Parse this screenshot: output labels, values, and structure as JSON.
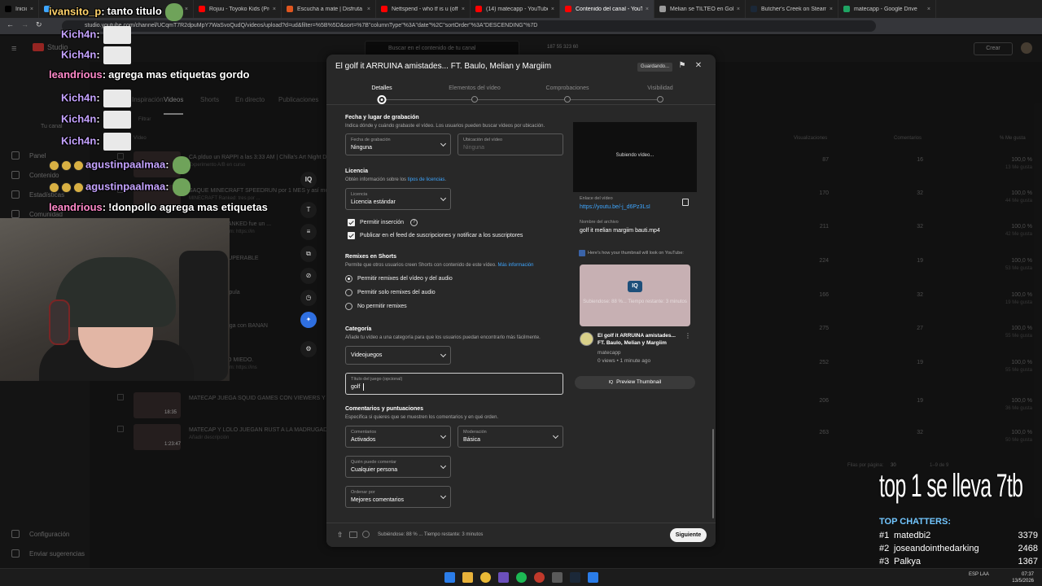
{
  "browser": {
    "tabs": [
      {
        "label": "Inicio / X",
        "color": "#000000",
        "active": false
      },
      {
        "label": "",
        "color": "#3ea6ff",
        "active": false
      },
      {
        "label": "Rojuu - Toyoko Kids (Prod By",
        "color": "#ff0000",
        "active": false
      },
      {
        "label": "Escucha a mate | Disfruta de l",
        "color": "#e0561f",
        "active": false
      },
      {
        "label": "Nettspend - who tf is u (offici",
        "color": "#ff0000",
        "active": false
      },
      {
        "label": "(14) matecapp - YouTube",
        "color": "#ff0000",
        "active": false
      },
      {
        "label": "Contenido del canal - YouTub",
        "color": "#ff0000",
        "active": true
      },
      {
        "label": "Melian se TILTEÓ en Golf It",
        "color": "#9a9a9a",
        "active": false
      },
      {
        "label": "Butcher's Creek on Steam",
        "color": "#1b2838",
        "active": false
      },
      {
        "label": "matecapp - Google Drive",
        "color": "#1fa463",
        "active": false
      }
    ],
    "url": "studio.youtube.com/channel/UCqmT7R2dpuMpY7WaSvoQudQ/videos/upload?d=ud&filter=%5B%5D&sort=%7B\"columnType\"%3A\"date\"%2C\"sortOrder\"%3A\"DESCENDING\"%7D"
  },
  "studio": {
    "search_placeholder": "Buscar en el contenido de tu canal",
    "header_stats": "187  55  323  60",
    "create_label": "Crear",
    "channel_label": "Tu canal",
    "sidebar": {
      "items": [
        "Panel",
        "Contenido",
        "Estadísticas",
        "Comunidad"
      ],
      "bottom": [
        "Configuración",
        "Enviar sugerencias"
      ]
    },
    "content_tabs": [
      "Inspiración",
      "Videos",
      "Shorts",
      "En directo",
      "Publicaciones"
    ],
    "filter_label": "Filtrar",
    "video_col": "Vídeo",
    "columns": [
      "Visualizaciones",
      "Comentarios",
      "% Me gusta"
    ],
    "rows": [
      {
        "title": "CA plduo un RAPPI a las 3:33 AM | Chilla's Art Night D",
        "sub": "Experimento A/B en curso",
        "views": "87",
        "comments": "16",
        "likes": "100,0 %",
        "likes_sub": "13 Me gusta"
      },
      {
        "title": "SAQUE MINECRAFT SPEEDRUN por 1 MES y así me m",
        "sub": "MINECRAFT Ranked: tres por ...",
        "views": "170",
        "comments": "32",
        "likes": "100,0 %",
        "likes_sub": "44 Me gusta"
      },
      {
        "title": "MINECRAFT RANKED fue un ...",
        "sub": "matecapp Instagram: https://in",
        "views": "211",
        "comments": "32",
        "likes": "100,0 %",
        "likes_sub": "42 Me gusta"
      },
      {
        "title": "ENTES ES INSUPERABLE",
        "sub": "",
        "views": "224",
        "comments": "19",
        "likes": "100,0 %",
        "likes_sub": "53 Me gusta"
      },
      {
        "title": "ausita... te manipula",
        "sub": "A/B completado",
        "views": "166",
        "comments": "32",
        "likes": "100,0 %",
        "likes_sub": "19 Me gusta"
      },
      {
        "title": "RC RIDERS juega con BANAN",
        "sub": "A/B completado",
        "views": "275",
        "comments": "27",
        "likes": "100,0 %",
        "likes_sub": "55 Me gusta"
      },
      {
        "title": "DE MUCHISIMO MIEDO.",
        "sub": "matecapp Instagram: https://ins",
        "views": "252",
        "comments": "19",
        "likes": "100,0 %",
        "likes_sub": "55 Me gusta"
      },
      {
        "title": "MATECAP JUEGA SQUID GAMES CON VIEWERS Y SE ENO",
        "sub": "",
        "duration": "18:35",
        "views": "206",
        "comments": "19",
        "likes": "100,0 %",
        "likes_sub": "36 Me gusta"
      },
      {
        "title": "MATECAP Y LOLO JUEGAN RUST A LA MADRUGADA. TER",
        "sub": "Añadir descripción",
        "duration": "1:23:47",
        "views": "263",
        "comments": "32",
        "likes": "100,0 %",
        "likes_sub": "50 Me gusta"
      }
    ],
    "pagination": {
      "label": "Filas por página:",
      "value": "30",
      "range": "1–9 de 9"
    }
  },
  "dialog": {
    "title": "El golf it ARRUINA amistades... FT. Baulo, Melian y Margiim",
    "saving": "Guardando...",
    "steps": [
      "Detalles",
      "Elementos del vídeo",
      "Comprobaciones",
      "Visibilidad"
    ],
    "fecha": {
      "heading": "Fecha y lugar de grabación",
      "desc": "Indica dónde y cuándo grabaste el vídeo. Los usuarios pueden buscar vídeos por ubicación.",
      "fecha_label": "Fecha de grabación",
      "fecha_value": "Ninguna",
      "ubic_label": "Ubicación del vídeo",
      "ubic_value": "Ninguna"
    },
    "licencia": {
      "heading": "Licencia",
      "desc_prefix": "Obtén información sobre los ",
      "desc_link": "tipos de licencias",
      "desc_suffix": ".",
      "label": "Licencia",
      "value": "Licencia estándar"
    },
    "checks": [
      "Permitir inserción",
      "Publicar en el feed de suscripciones y notificar a los suscriptores"
    ],
    "remixes": {
      "heading": "Remixes en Shorts",
      "desc": "Permite que otros usuarios creen Shorts con contenido de este vídeo. ",
      "desc_link": "Más información",
      "options": [
        "Permitir remixes del vídeo y del audio",
        "Permitir solo remixes del audio",
        "No permitir remixes"
      ]
    },
    "categoria": {
      "heading": "Categoría",
      "desc": "Añade tu vídeo a una categoría para que los usuarios puedan encontrarlo más fácilmente.",
      "value": "Videojuegos",
      "game_label": "Título del juego (opcional)",
      "game_value": "golf"
    },
    "comentarios": {
      "heading": "Comentarios y puntuaciones",
      "desc": "Especifica si quieres que se muestren los comentarios y en qué orden.",
      "com_label": "Comentarios",
      "com_value": "Activados",
      "mod_label": "Moderación",
      "mod_value": "Básica",
      "who_label": "Quién puede comentar",
      "who_value": "Cualquier persona",
      "order_label": "Ordenar por",
      "order_value": "Mejores comentarios"
    },
    "side": {
      "uploading": "Subiendo vídeo...",
      "link_label": "Enlace del vídeo",
      "link_value": "https://youtu.be/-j_d6Pz3LsI",
      "file_label": "Nombre del archivo",
      "file_value": "golf it melian margiim bauti.mp4",
      "thumb_note_header": "Here's how your thumbnail will look on YouTube:",
      "thumb_badge": "IQ",
      "thumb_overlay": "Subiendose: 88 %... Tiempo restante: 3 minutos",
      "card_title": "El golf it ARRUINA amistades... FT. Baulo, Melian y Margiim",
      "card_channel": "matecapp",
      "card_meta": "0 views • 1 minute ago",
      "preview_btn": "Preview Thumbnail"
    },
    "footer_status": "Subiéndose: 88 % ... Tiempo restante: 3 minutos",
    "next": "Siguiente"
  },
  "tools": [
    "IQ",
    "T",
    "≡",
    "⧉",
    "⊘",
    "◷",
    "✦",
    "⚙"
  ],
  "chat": [
    {
      "user": "ivansito_p",
      "msg": "tanto titulo",
      "color": "#ffd36b"
    },
    {
      "user": "Kich4n",
      "msg": "",
      "color": "#c5a3ff"
    },
    {
      "user": "Kich4n",
      "msg": "",
      "color": "#c5a3ff"
    },
    {
      "user": "leandrious",
      "msg": "agrega mas etiquetas gordo",
      "color": "#ff89c9"
    },
    {
      "user": "Kich4n",
      "msg": "",
      "color": "#c5a3ff"
    },
    {
      "user": "Kich4n",
      "msg": "",
      "color": "#c5a3ff"
    },
    {
      "user": "Kich4n",
      "msg": "",
      "color": "#c5a3ff"
    },
    {
      "user": "agustinpaalmaa",
      "msg": "",
      "color": "#c5a3ff"
    },
    {
      "user": "agustinpaalmaa",
      "msg": "",
      "color": "#c5a3ff"
    },
    {
      "user": "leandrious",
      "msg": "!donpollo agrega mas etiquetas",
      "color": "#ff89c9"
    }
  ],
  "stream_overlay": {
    "banner": "top 1 se lleva 7tb",
    "chatters_header": "TOP CHATTERS:",
    "chatters": [
      {
        "rank": "#1",
        "name": "matedbi2",
        "count": "3379"
      },
      {
        "rank": "#2",
        "name": "joseandointhedarking",
        "count": "2468"
      },
      {
        "rank": "#3",
        "name": "Palkya",
        "count": "1367"
      }
    ]
  },
  "taskbar": {
    "lang": "ESP LAA",
    "time": "07:37",
    "date": "13/5/2026"
  }
}
